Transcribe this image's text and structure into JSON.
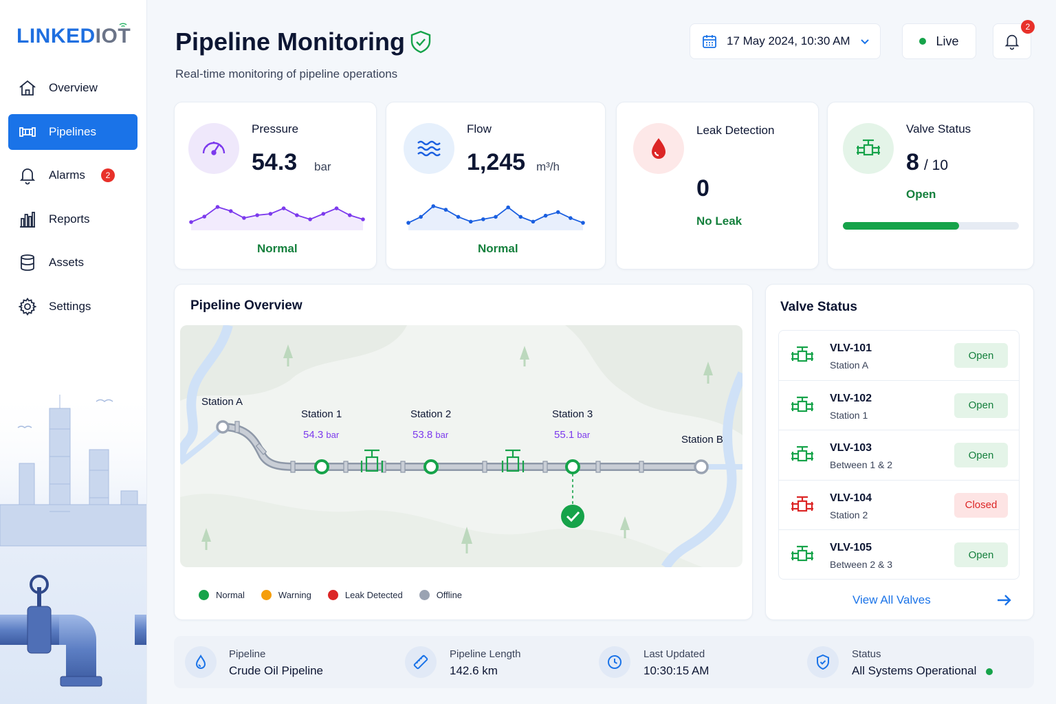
{
  "app": {
    "logo_main": "LINKED",
    "logo_accent": "IOT"
  },
  "sidebar": {
    "items": [
      {
        "label": "Overview",
        "icon": "home-icon"
      },
      {
        "label": "Pipelines",
        "icon": "pipeline-icon",
        "active": true
      },
      {
        "label": "Alarms",
        "icon": "bell-icon",
        "badge": "2"
      },
      {
        "label": "Reports",
        "icon": "bar-chart-icon"
      },
      {
        "label": "Assets",
        "icon": "database-icon"
      },
      {
        "label": "Settings",
        "icon": "gear-icon"
      }
    ]
  },
  "header": {
    "title": "Pipeline Monitoring",
    "subtitle": "Real-time monitoring of pipeline operations",
    "datetime": "17 May 2024, 10:30 AM",
    "live_label": "Live",
    "notification_count": "2"
  },
  "kpis": {
    "pressure": {
      "label": "Pressure",
      "value": "54.3",
      "unit": "bar",
      "status": "Normal",
      "trend": [
        44,
        48,
        55,
        52,
        47,
        49,
        50,
        54,
        49,
        46,
        50,
        54,
        49,
        46
      ]
    },
    "flow": {
      "label": "Flow",
      "value": "1,245",
      "unit": "m³/h",
      "status": "Normal",
      "trend": [
        42,
        47,
        56,
        53,
        47,
        43,
        45,
        47,
        55,
        47,
        43,
        48,
        51,
        46,
        42
      ]
    },
    "leak": {
      "label": "Leak Detection",
      "value": "0",
      "status": "No Leak"
    },
    "valve": {
      "label": "Valve Status",
      "value": "8",
      "total": "/ 10",
      "status": "Open",
      "open_fraction": 0.8
    }
  },
  "overview": {
    "title": "Pipeline Overview",
    "stations": [
      {
        "name": "Station A",
        "pressure": "",
        "status": "offline"
      },
      {
        "name": "Station 1",
        "pressure": "54.3",
        "unit": "bar",
        "status": "normal"
      },
      {
        "name": "Station 2",
        "pressure": "53.8",
        "unit": "bar",
        "status": "normal"
      },
      {
        "name": "Station 3",
        "pressure": "55.1",
        "unit": "bar",
        "status": "normal"
      },
      {
        "name": "Station B",
        "pressure": "",
        "status": "offline"
      }
    ],
    "legend": [
      {
        "label": "Normal",
        "color": "#16a34a"
      },
      {
        "label": "Warning",
        "color": "#f59e0b"
      },
      {
        "label": "Leak Detected",
        "color": "#dc2626"
      },
      {
        "label": "Offline",
        "color": "#9aa3b2"
      }
    ]
  },
  "valves": {
    "title": "Valve Status",
    "rows": [
      {
        "id": "VLV-101",
        "location": "Station A",
        "status": "Open"
      },
      {
        "id": "VLV-102",
        "location": "Station 1",
        "status": "Open"
      },
      {
        "id": "VLV-103",
        "location": "Between 1 & 2",
        "status": "Open"
      },
      {
        "id": "VLV-104",
        "location": "Station 2",
        "status": "Closed"
      },
      {
        "id": "VLV-105",
        "location": "Between 2 & 3",
        "status": "Open"
      }
    ],
    "view_all": "View All Valves"
  },
  "footer": {
    "pipeline": {
      "label": "Pipeline",
      "value": "Crude Oil Pipeline"
    },
    "length": {
      "label": "Pipeline Length",
      "value": "142.6 km"
    },
    "updated": {
      "label": "Last Updated",
      "value": "10:30:15 AM"
    },
    "status": {
      "label": "Status",
      "value": "All Systems Operational"
    }
  },
  "colors": {
    "accent": "#1a73e8",
    "normal": "#16a34a",
    "danger": "#dc2626",
    "pressure_line": "#7c3aed",
    "flow_line": "#1a5fe0"
  }
}
